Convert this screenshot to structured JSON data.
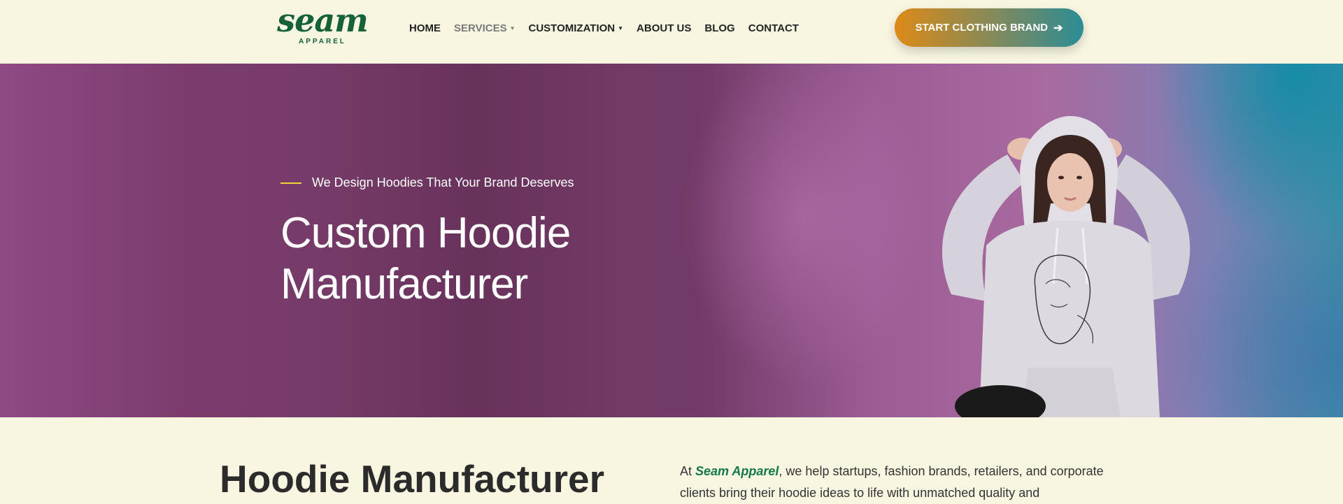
{
  "header": {
    "logo": {
      "word": "seam",
      "sub": "APPAREL"
    },
    "nav": [
      {
        "label": "HOME",
        "dropdown": false,
        "active": false
      },
      {
        "label": "SERVICES",
        "dropdown": true,
        "active": true
      },
      {
        "label": "CUSTOMIZATION",
        "dropdown": true,
        "active": false
      },
      {
        "label": "ABOUT US",
        "dropdown": false,
        "active": false
      },
      {
        "label": "BLOG",
        "dropdown": false,
        "active": false
      },
      {
        "label": "CONTACT",
        "dropdown": false,
        "active": false
      }
    ],
    "cta": {
      "label": "START CLOTHING BRAND",
      "icon": "arrow-right-icon"
    }
  },
  "hero": {
    "eyebrow": "We Design Hoodies That Your Brand Deserves",
    "title_line1": "Custom Hoodie",
    "title_line2": "Manufacturer",
    "image": "woman-in-white-hoodie-photo"
  },
  "intro": {
    "title": "Hoodie Manufacturer",
    "para_prefix": "At ",
    "para_brand": "Seam Apparel",
    "para_rest": ", we help startups, fashion brands, retailers, and corporate clients bring their hoodie ideas to life with unmatched quality and"
  },
  "colors": {
    "background": "#f8f5e1",
    "brand_green": "#14613a",
    "cta_gradient_start": "#dd8a17",
    "cta_gradient_end": "#2b8c96",
    "eyebrow_line": "#f1d33b"
  }
}
